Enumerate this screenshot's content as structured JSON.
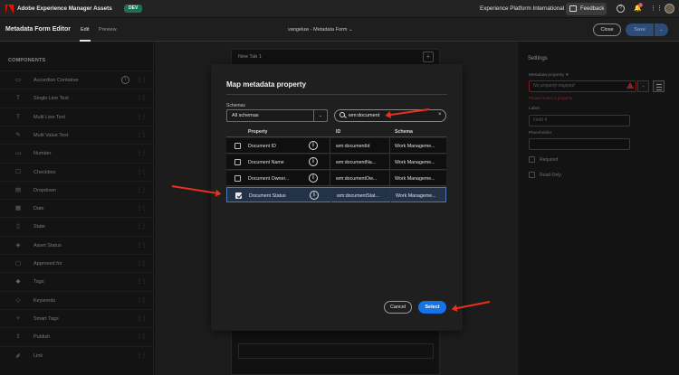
{
  "topbar": {
    "app_name": "Adobe Experience Manager Assets",
    "env_badge": "DEV",
    "org_name": "Experience Platform International",
    "feedback_label": "Feedback",
    "notification_count": "2",
    "help_glyph": "?",
    "bell_glyph": "🔔",
    "grid_glyph": "⋮⋮"
  },
  "subbar": {
    "editor_title": "Metadata Form Editor",
    "tabs": [
      "Edit",
      "Preview"
    ],
    "form_name": "vangeluw - Metadata Form",
    "form_name_caret": "⌄",
    "close_label": "Close",
    "save_label": "Save",
    "save_caret": "⌄"
  },
  "components": {
    "heading": "COMPONENTS",
    "items": [
      {
        "label": "Accordion Container",
        "icon": "accordion-icon",
        "glyph": "▭"
      },
      {
        "label": "Single Line Text",
        "icon": "text-icon",
        "glyph": "T"
      },
      {
        "label": "Multi Line Text",
        "icon": "text-icon",
        "glyph": "T"
      },
      {
        "label": "Multi Value Text",
        "icon": "pencil-icon",
        "glyph": "✎"
      },
      {
        "label": "Number",
        "icon": "number-icon",
        "glyph": "123"
      },
      {
        "label": "Checkbox",
        "icon": "checkbox-icon",
        "glyph": "☐"
      },
      {
        "label": "Dropdown",
        "icon": "dropdown-icon",
        "glyph": "▤"
      },
      {
        "label": "Date",
        "icon": "calendar-icon",
        "glyph": "▦"
      },
      {
        "label": "State",
        "icon": "state-icon",
        "glyph": "▯"
      },
      {
        "label": "Asset Status",
        "icon": "status-icon",
        "glyph": "◈"
      },
      {
        "label": "Approved for",
        "icon": "approved-icon",
        "glyph": "▢"
      },
      {
        "label": "Tags",
        "icon": "tag-icon",
        "glyph": "◆"
      },
      {
        "label": "Keywords",
        "icon": "keyword-icon",
        "glyph": "◇"
      },
      {
        "label": "Smart Tags",
        "icon": "smart-tag-icon",
        "glyph": "✧"
      },
      {
        "label": "Publish",
        "icon": "publish-icon",
        "glyph": "⇪"
      },
      {
        "label": "Link",
        "icon": "link-icon",
        "glyph": "🔗"
      }
    ],
    "info_glyph": "i",
    "drag_glyph": "⋮⋮"
  },
  "canvas": {
    "tab_label": "New Tab 1",
    "add_glyph": "+"
  },
  "settings": {
    "title": "Settings",
    "metadata_property_label": "Metadata property ∗",
    "metadata_property_placeholder": "No property mapped",
    "metadata_error": "Please select a property",
    "label_label": "Label",
    "label_value": "Field 4",
    "placeholder_label": "Placeholder",
    "placeholder_value": "",
    "required_label": "Required",
    "readonly_label": "Read-Only",
    "caret_glyph": "⌄"
  },
  "dialog": {
    "title": "Map metadata property",
    "schemas_label": "Schemas",
    "schema_value": "All schemas",
    "schema_caret": "⌄",
    "search_value": "wm:document",
    "clear_glyph": "×",
    "columns": [
      "Property",
      "ID",
      "Schema"
    ],
    "rows": [
      {
        "property": "Document ID",
        "id": "wm:documentId",
        "schema": "Work Manageme...",
        "checked": false
      },
      {
        "property": "Document Name",
        "id": "wm:documentNa...",
        "schema": "Work Manageme...",
        "checked": false
      },
      {
        "property": "Document Owner...",
        "id": "wm:documentOw...",
        "schema": "Work Manageme...",
        "checked": false
      },
      {
        "property": "Document Status",
        "id": "wm:documentStat...",
        "schema": "Work Manageme...",
        "checked": true
      }
    ],
    "info_glyph": "i",
    "cancel_label": "Cancel",
    "select_label": "Select"
  },
  "colors": {
    "accent": "#1473e6",
    "annotation": "#e8311f",
    "env_badge": "#1f6f56",
    "error": "#d7373f"
  }
}
